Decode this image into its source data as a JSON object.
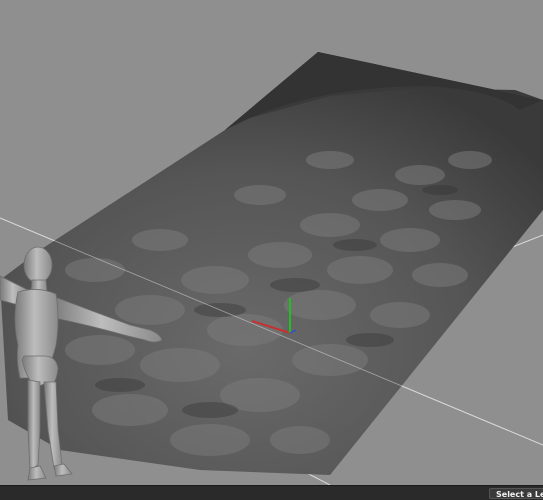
{
  "viewport": {
    "background_color": "#8f8f8f",
    "terrain_color": "#4a4a4a",
    "grid_line_color": "#e8e8e8",
    "axis_x_color": "#c83030",
    "axis_y_color": "#20c020",
    "figure_color": "#9a9a9a"
  },
  "statusbar": {
    "lesson_button_label": "Select a Less"
  }
}
